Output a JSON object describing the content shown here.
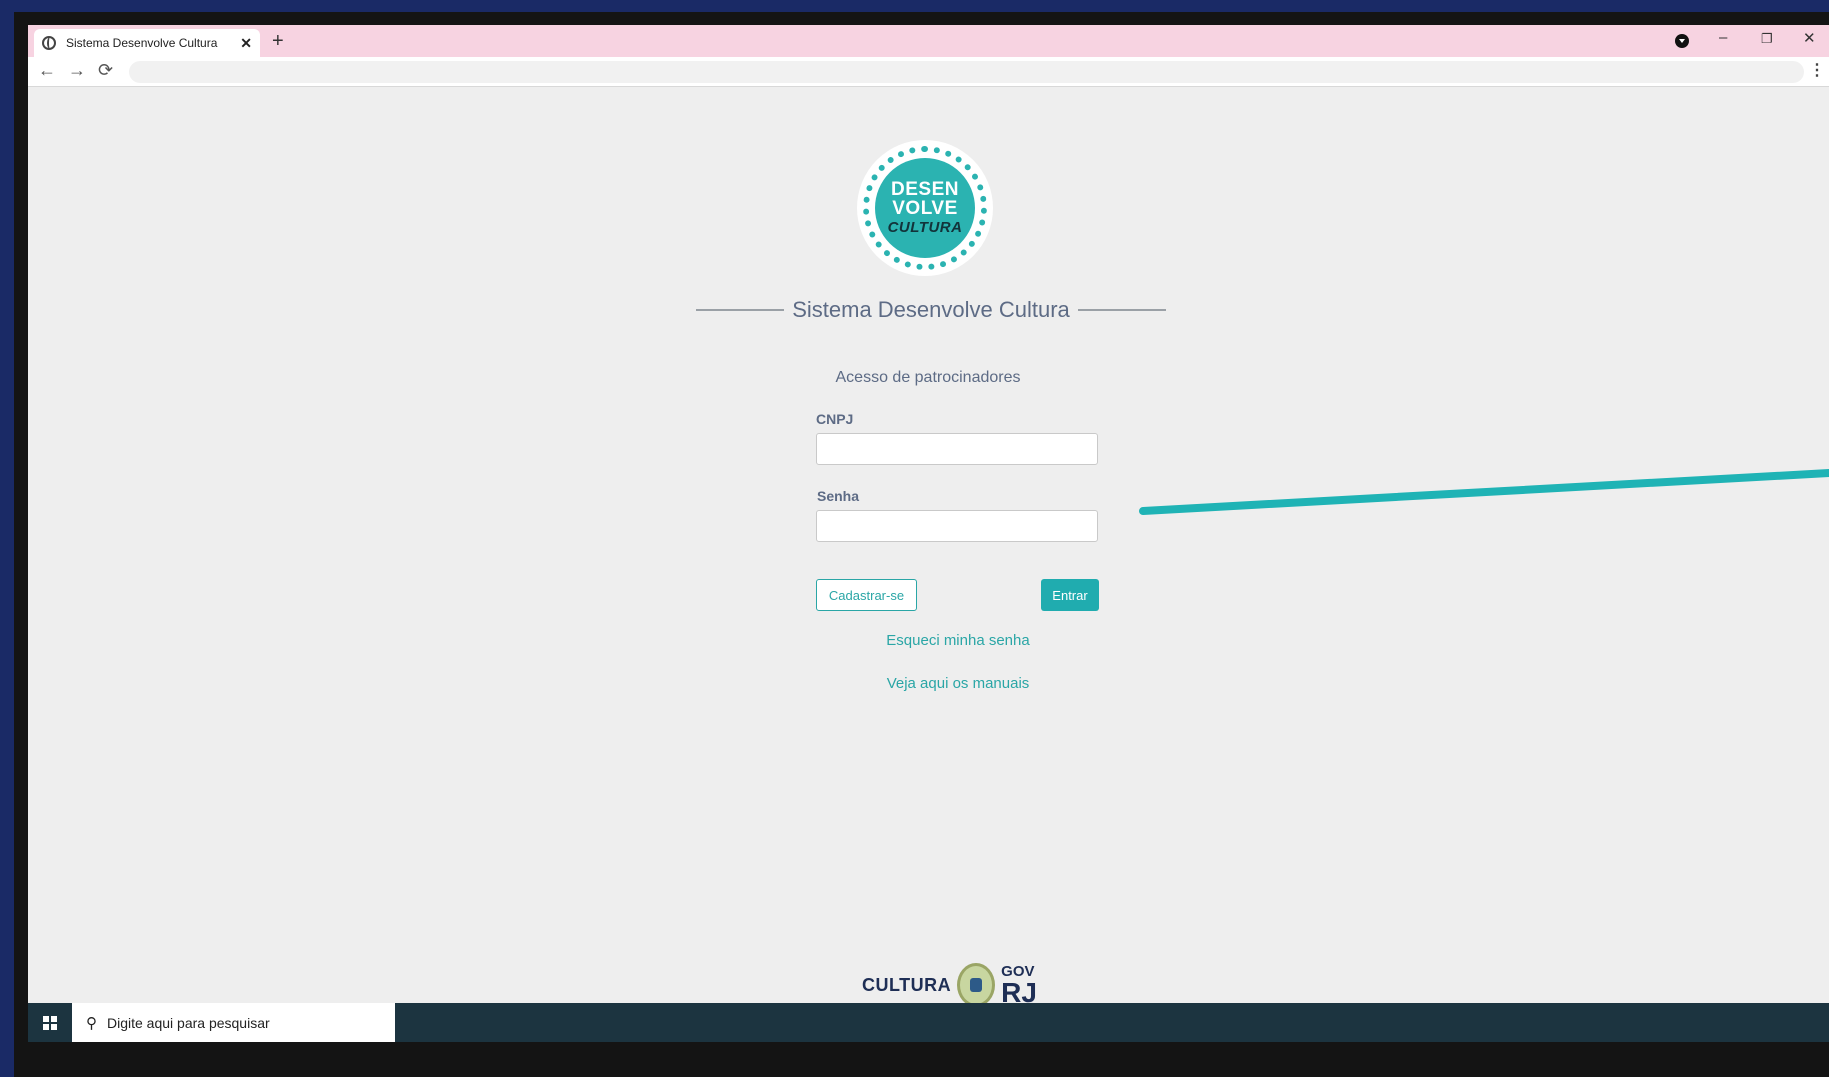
{
  "browser": {
    "tab_title": "Sistema Desenvolve Cultura",
    "tab_close": "✕",
    "new_tab": "+",
    "back_icon": "←",
    "forward_icon": "→",
    "reload_icon": "⟳",
    "menu_icon": "⋮",
    "minimize": "–",
    "restore": "❐",
    "close": "✕"
  },
  "logo": {
    "lines": [
      "DESEN",
      "VOLVE",
      "CULTURA"
    ]
  },
  "page": {
    "title": "Sistema Desenvolve Cultura",
    "subtitle": "Acesso de patrocinadores",
    "cnpj_label": "CNPJ",
    "cnpj_value": "",
    "senha_label": "Senha",
    "senha_value": "",
    "register_button": "Cadastrar-se",
    "login_button": "Entrar",
    "forgot_link": "Esqueci minha senha",
    "manuals_link": "Veja aqui os manuais"
  },
  "footer": {
    "cultura": "CULTURA",
    "gov": "GOV",
    "rj": "RJ"
  },
  "taskbar": {
    "search_placeholder": "Digite aqui para pesquisar",
    "search_icon": "⚲"
  },
  "colors": {
    "accent": "#20acaf",
    "tabstrip": "#f7d3e1",
    "text": "#5d6b85",
    "annotation": "#1fb3b5"
  }
}
